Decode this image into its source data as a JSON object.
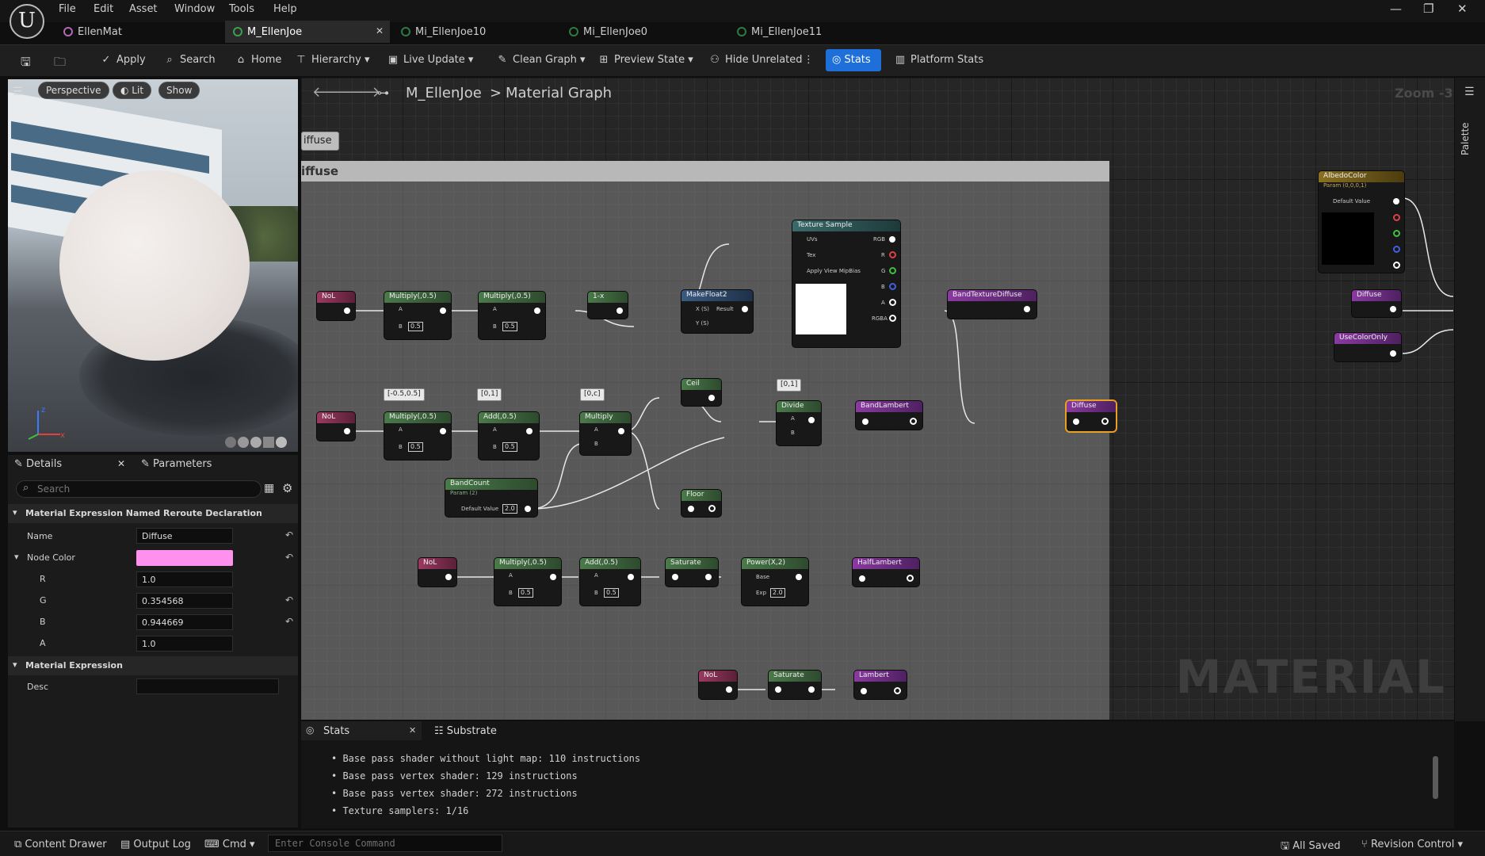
{
  "menu": {
    "items": [
      "File",
      "Edit",
      "Asset",
      "Window",
      "Tools",
      "Help"
    ]
  },
  "tabs": [
    {
      "label": "EllenMat",
      "active": false
    },
    {
      "label": "M_EllenJoe",
      "active": true
    },
    {
      "label": "Mi_EllenJoe10",
      "active": false
    },
    {
      "label": "Mi_EllenJoe0",
      "active": false
    },
    {
      "label": "Mi_EllenJoe11",
      "active": false
    }
  ],
  "window": {
    "minimize": "—",
    "restore": "❐",
    "close": "✕"
  },
  "toolbar": {
    "apply": "Apply",
    "search": "Search",
    "home": "Home",
    "hierarchy": "Hierarchy",
    "live_update": "Live Update",
    "clean_graph": "Clean Graph",
    "preview_state": "Preview State",
    "hide_unrelated": "Hide Unrelated",
    "stats": "Stats",
    "platform_stats": "Platform Stats"
  },
  "viewport": {
    "perspective": "Perspective",
    "lit": "Lit",
    "show": "Show"
  },
  "details": {
    "tab_details": "Details",
    "tab_parameters": "Parameters",
    "search_placeholder": "Search",
    "section1": "Material Expression Named Reroute Declaration",
    "name_label": "Name",
    "name_value": "Diffuse",
    "node_color_label": "Node Color",
    "node_color": "#ff91ee",
    "r_label": "R",
    "r_value": "1.0",
    "g_label": "G",
    "g_value": "0.354568",
    "b_label": "B",
    "b_value": "0.944669",
    "a_label": "A",
    "a_value": "1.0",
    "section2": "Material Expression",
    "desc_label": "Desc",
    "desc_value": ""
  },
  "graph": {
    "breadcrumb_asset": "M_EllenJoe",
    "breadcrumb_sep": ">",
    "breadcrumb_graph": "Material Graph",
    "zoom": "Zoom -3",
    "palette": "Palette",
    "comment_bubble": "iffuse",
    "comment_title": "iffuse",
    "watermark": "MATERIAL",
    "nodes": {
      "nol1": "NoL",
      "mul1": "Multiply(,0.5)",
      "mul2": "Multiply(,0.5)",
      "oneminus": "1-x",
      "makefloat": "MakeFloat2",
      "texsample": "Texture Sample",
      "bandtex": "BandTextureDiffuse",
      "diffuse_reroute": "Diffuse",
      "nol2": "NoL",
      "mul3": "Multiply(,0.5)",
      "add1": "Add(,0.5)",
      "mul4": "Multiply",
      "ceil": "Ceil",
      "divide": "Divide",
      "bandlambert": "BandLambert",
      "bandcount": "BandCount",
      "bandcount_sub": "Param (2)",
      "floor": "Floor",
      "nol3": "NoL",
      "mul5": "Multiply(,0.5)",
      "add2": "Add(,0.5)",
      "sat1": "Saturate",
      "power": "Power(X,2)",
      "halflambert": "HalfLambert",
      "nol4": "NoL",
      "sat2": "Saturate",
      "lambert": "Lambert",
      "albedo": "AlbedoColor",
      "albedo_sub": "Param (0,0,0,1)",
      "diffuse2": "Diffuse",
      "usecoloronly": "UseColorOnly"
    },
    "pins": {
      "a": "A",
      "b": "B",
      "x": "X (S)",
      "y": "Y (S)",
      "result": "Result",
      "uvs": "UVs",
      "tex": "Tex",
      "mip": "Apply View MipBias",
      "rgb": "RGB",
      "r": "R",
      "g": "G",
      "bb": "B",
      "aa": "A",
      "rgba": "RGBA",
      "base": "Base",
      "exp": "Exp",
      "default_value": "Default Value"
    },
    "values": {
      "v05": "0.5",
      "v20": "2.0",
      "tag1": "[-0.5,0.5]",
      "tag2": "[0,1]",
      "tag3": "[0,c]",
      "tag4": "[0,1]"
    }
  },
  "stats_panel": {
    "tab_stats": "Stats",
    "tab_substrate": "Substrate",
    "lines": [
      "Base pass shader without light map: 110 instructions",
      "Base pass vertex shader: 129 instructions",
      "Base pass vertex shader: 272 instructions",
      "Texture samplers: 1/16"
    ]
  },
  "statusbar": {
    "content_drawer": "Content Drawer",
    "output_log": "Output Log",
    "cmd": "Cmd",
    "console_placeholder": "Enter Console Command",
    "all_saved": "All Saved",
    "revision_control": "Revision Control"
  }
}
